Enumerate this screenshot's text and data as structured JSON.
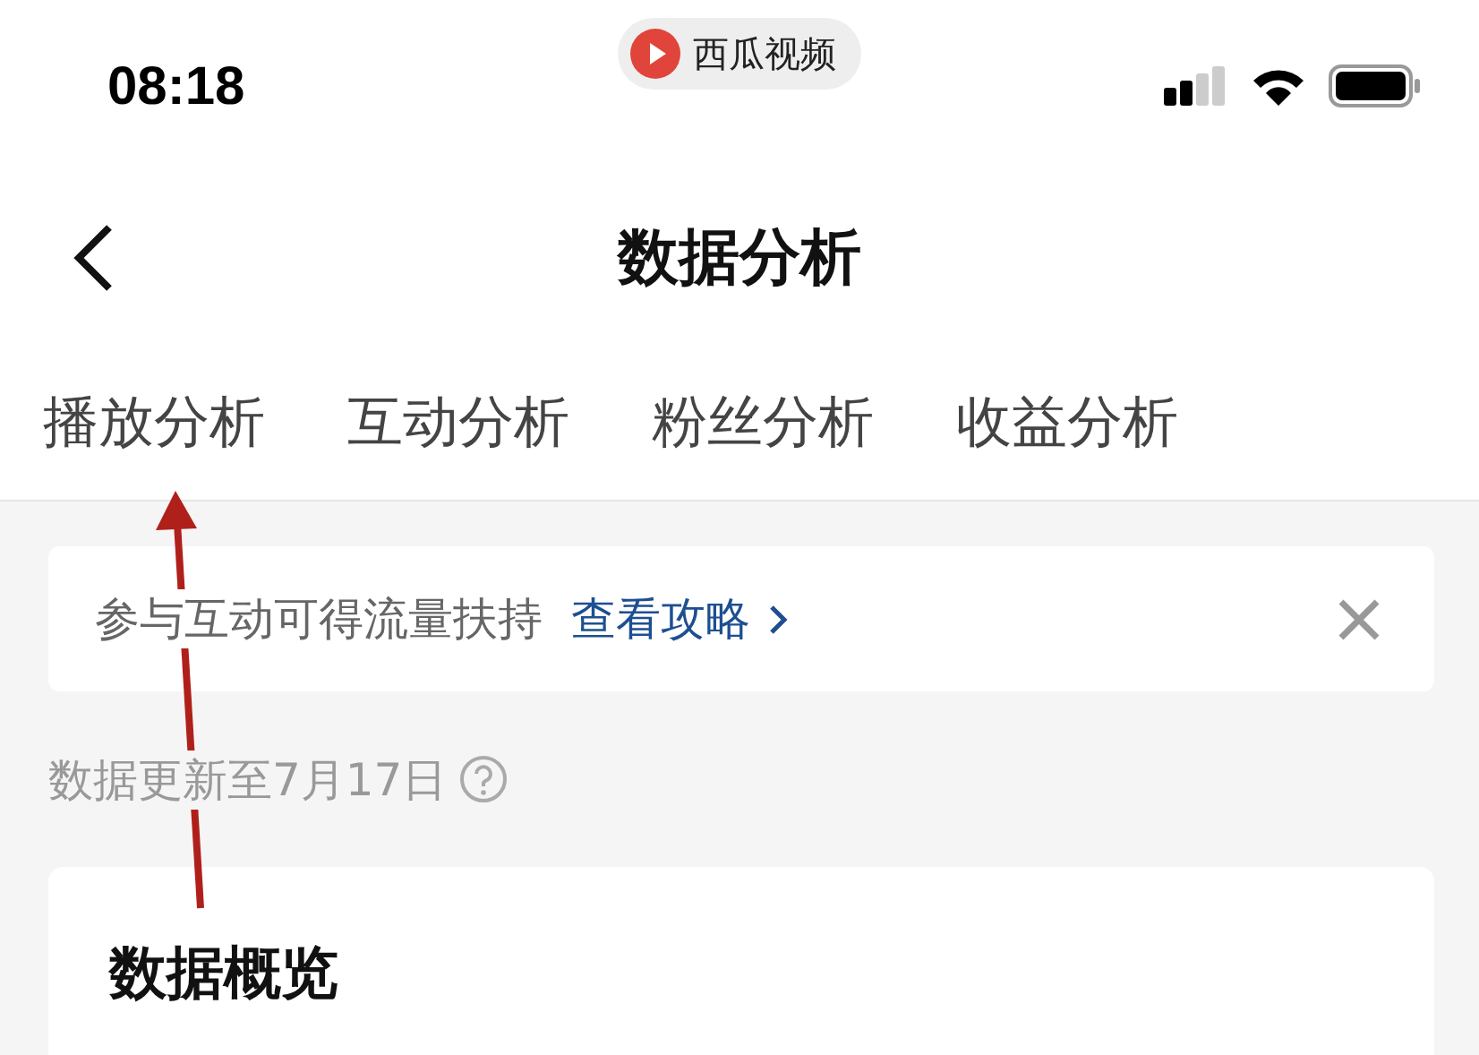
{
  "status_bar": {
    "time": "08:18",
    "app_badge": "西瓜视频"
  },
  "nav_bar": {
    "title": "数据分析"
  },
  "tabs": [
    {
      "label": "播放分析",
      "selected": false
    },
    {
      "label": "互动分析",
      "selected": false
    },
    {
      "label": "粉丝分析",
      "selected": false
    },
    {
      "label": "收益分析",
      "selected": false
    }
  ],
  "banner": {
    "text": "参与互动可得流量扶持",
    "link": "查看攻略"
  },
  "update_note": "数据更新至7月17日",
  "overview_card": {
    "title": "数据概览"
  },
  "annotation": {
    "kind": "arrow"
  }
}
